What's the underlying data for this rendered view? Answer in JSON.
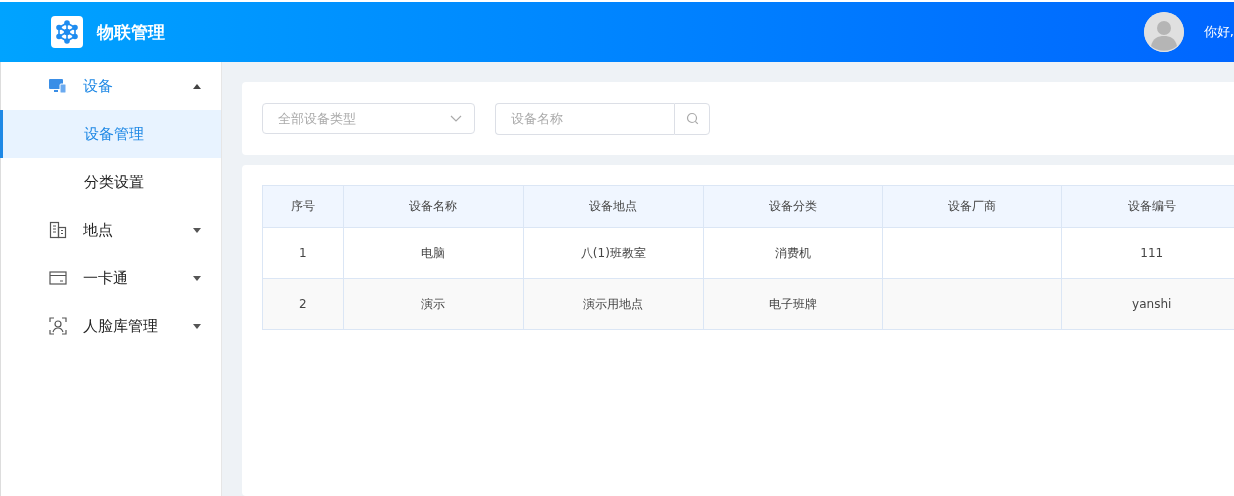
{
  "header": {
    "title": "物联管理",
    "greeting": "你好,"
  },
  "sidebar": {
    "items": [
      {
        "label": "设备",
        "expanded": true,
        "children": [
          {
            "label": "设备管理",
            "selected": true
          },
          {
            "label": "分类设置",
            "selected": false
          }
        ]
      },
      {
        "label": "地点",
        "expanded": false
      },
      {
        "label": "一卡通",
        "expanded": false
      },
      {
        "label": "人脸库管理",
        "expanded": false
      }
    ]
  },
  "filters": {
    "type_select": {
      "placeholder": "全部设备类型"
    },
    "search": {
      "placeholder": "设备名称"
    }
  },
  "table": {
    "columns": [
      "序号",
      "设备名称",
      "设备地点",
      "设备分类",
      "设备厂商",
      "设备编号"
    ],
    "rows": [
      {
        "cells": [
          "1",
          "电脑",
          "八(1)班教室",
          "消费机",
          null,
          "111"
        ]
      },
      {
        "cells": [
          "2",
          "演示",
          "演示用地点",
          "电子班牌",
          null,
          "yanshi"
        ]
      }
    ]
  }
}
